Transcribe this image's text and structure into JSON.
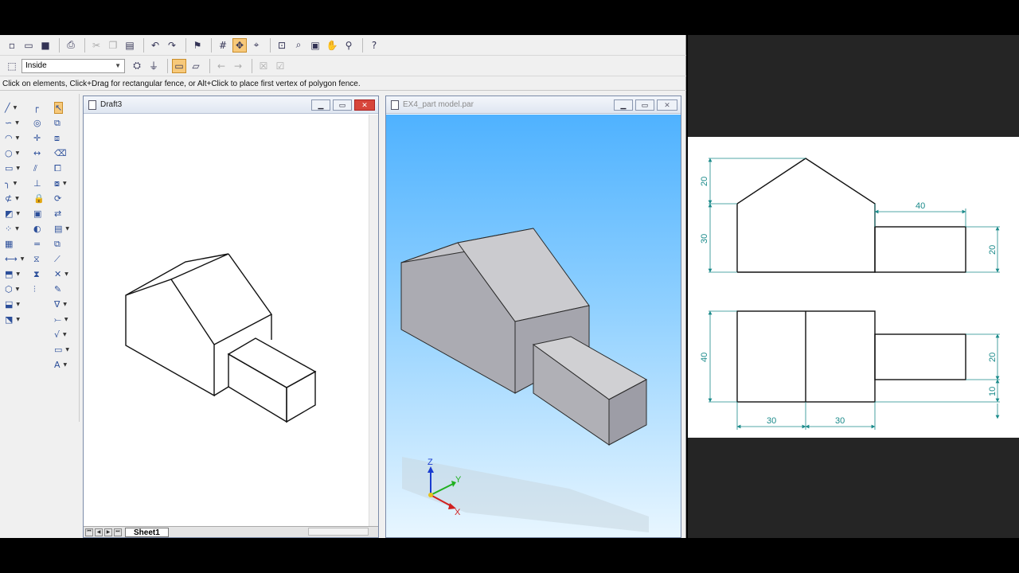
{
  "toolbar": {
    "combo_value": "Inside"
  },
  "prompt_bar": {
    "text": "Click on elements, Click+Drag for rectangular fence, or Alt+Click to place first vertex of polygon fence."
  },
  "windows": {
    "draft": {
      "title": "Draft3",
      "sheet_tab": "Sheet1"
    },
    "part": {
      "title": "EX4_part model.par"
    }
  },
  "triad": {
    "x_label": "X",
    "y_label": "Y",
    "z_label": "Z"
  },
  "orthographic_dims": {
    "front_top_height": "20",
    "front_lower_height": "30",
    "front_ext_width": "40",
    "front_ext_height": "20",
    "top_depth": "40",
    "top_ext_height": "20",
    "top_offset": "10",
    "top_width_left": "30",
    "top_width_right": "30"
  },
  "colors": {
    "dimension": "#1a8a8a",
    "model_face_light": "#c8c8cc",
    "model_face_dark": "#a8a8ae",
    "sky_top": "#4fb2ff",
    "sky_bottom": "#e8f6ff"
  }
}
